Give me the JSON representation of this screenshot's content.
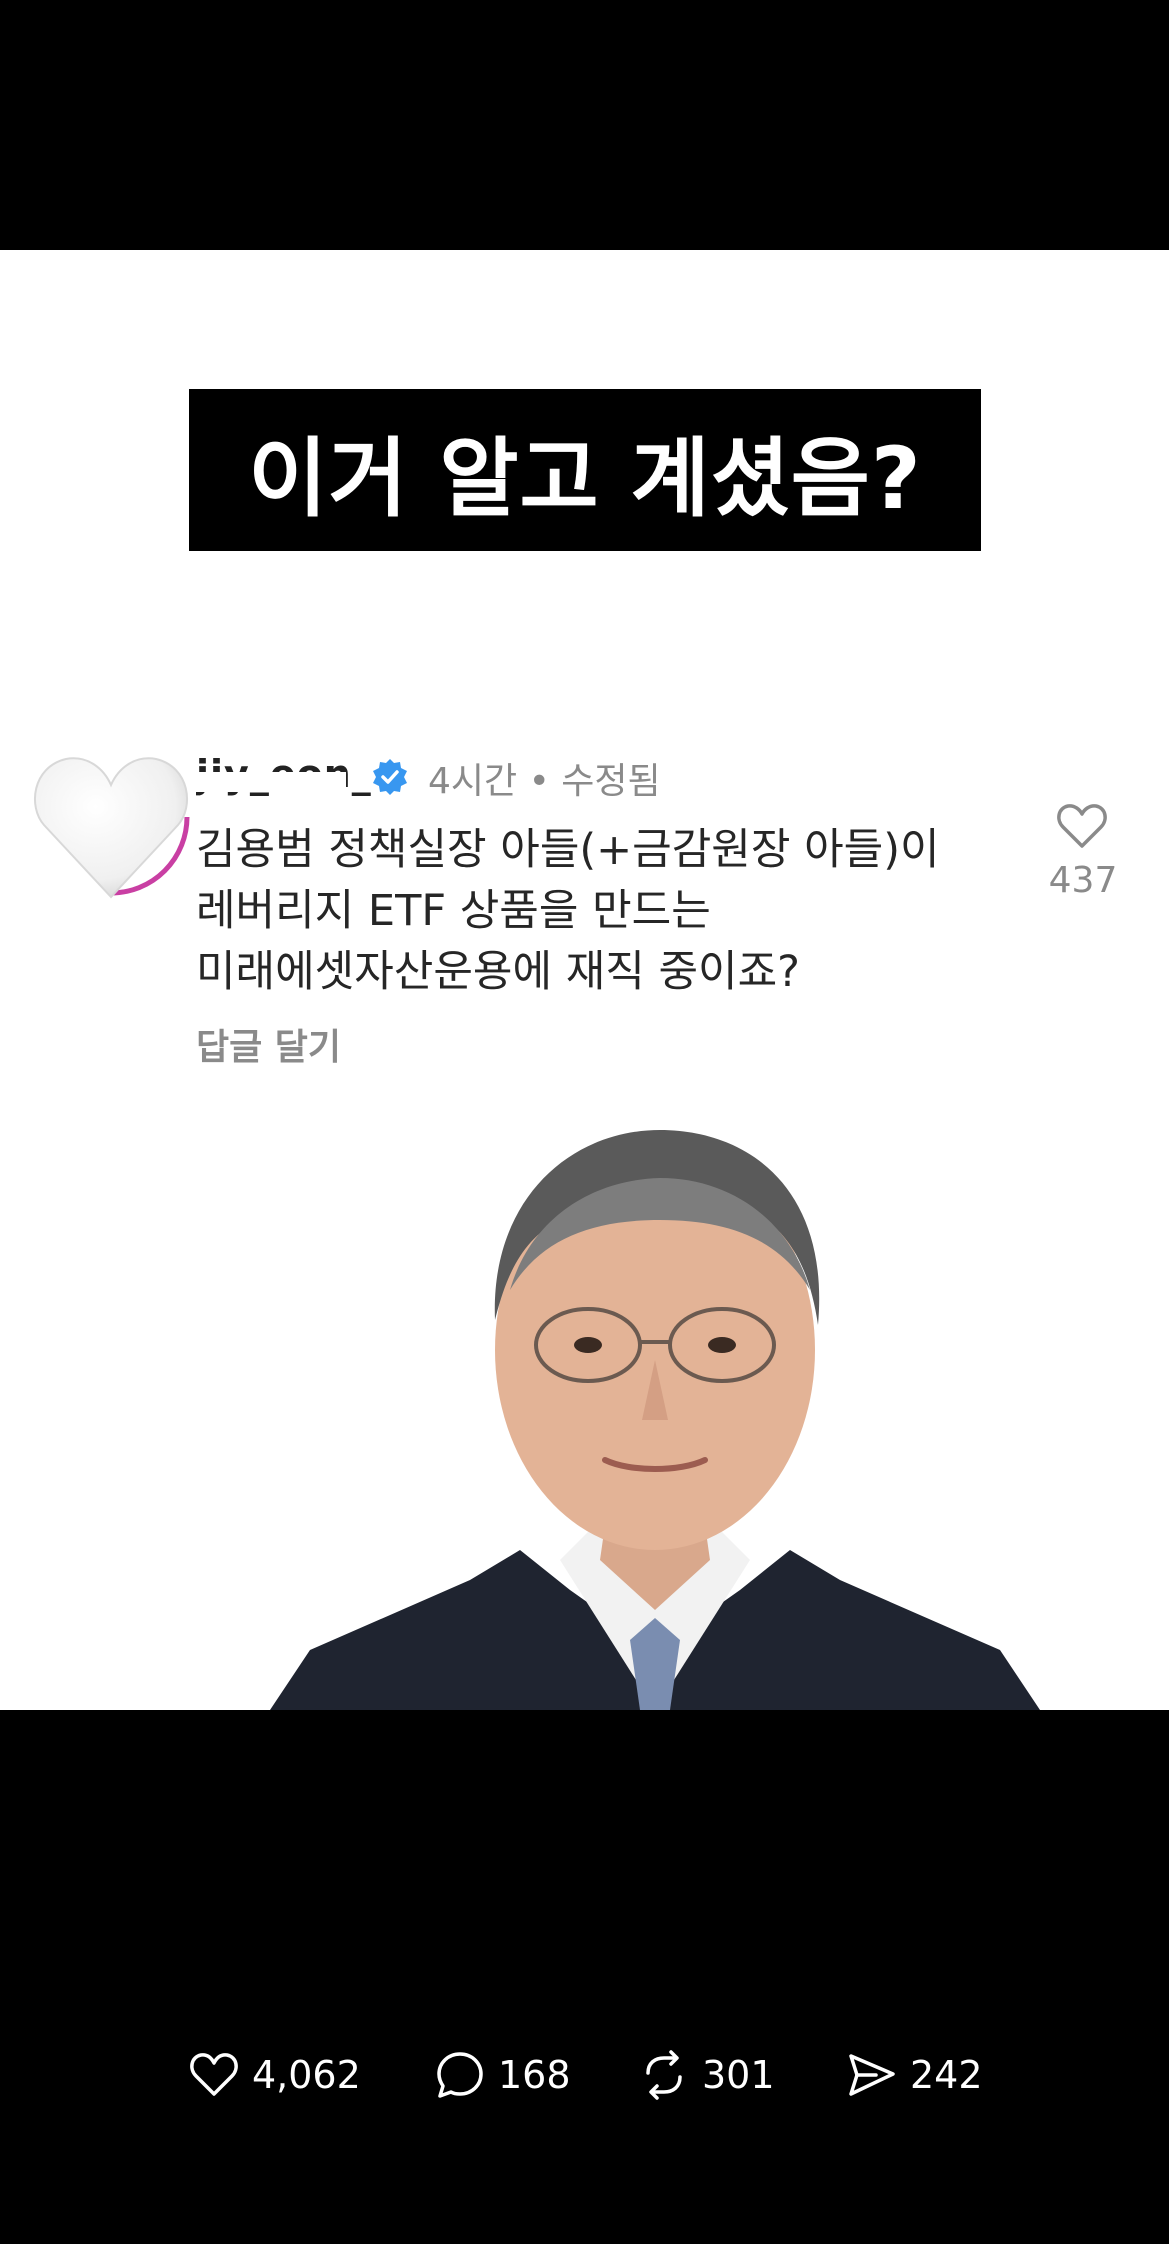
{
  "headline": "이거 알고 계셨음?",
  "comment": {
    "username": "jiy_eon_",
    "time_label": "4시간 • 수정됨",
    "lines": [
      "김용범 정책실장 아들(+금감원장 아들)이",
      "레버리지 ETF 상품을 만드는",
      "미래에셋자산운용에 재직 중이죠?"
    ],
    "reply_label": "답글 달기",
    "like_count": "437"
  },
  "actions": {
    "likes": "4,062",
    "comments": "168",
    "reposts": "301",
    "shares": "242"
  },
  "icons": [
    "white-heart-emoji",
    "verified-badge-icon",
    "heart-outline-icon",
    "comment-icon",
    "repost-icon",
    "send-icon"
  ],
  "colors": {
    "verified": "#3897f0",
    "muted_text": "#8a8a8a",
    "background": "#000000"
  }
}
